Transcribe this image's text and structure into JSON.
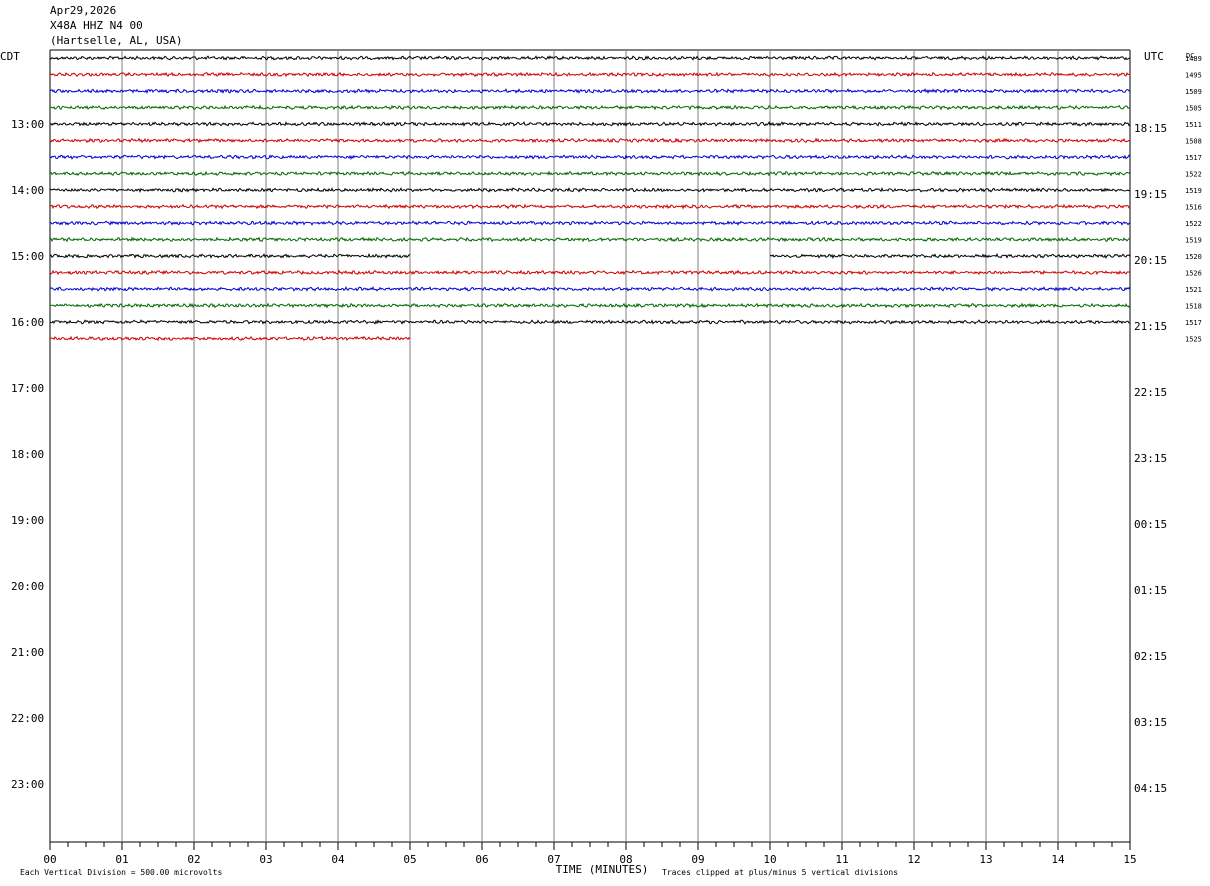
{
  "header": {
    "date": "Apr29,2026",
    "station": "X48A HHZ N4 00",
    "location": "(Hartselle, AL, USA)"
  },
  "labels": {
    "left_tz": "CDT",
    "right_tz": "UTC",
    "dc": "DC"
  },
  "footer": {
    "scale_note": "Each Vertical Division =  500.00 microvolts",
    "clip_note": "Traces clipped at plus/minus 5 vertical divisions"
  },
  "colors": {
    "trace_cycle": [
      "#000000",
      "#cc0000",
      "#0000cc",
      "#006600"
    ],
    "grid": "#7f7f7f"
  },
  "chart_data": {
    "type": "line",
    "title": "X48A HHZ N4 00",
    "xlabel": "TIME (MINUTES)",
    "ylabel": "",
    "xlim": [
      0,
      15
    ],
    "x_ticks": [
      "00",
      "01",
      "02",
      "03",
      "04",
      "05",
      "06",
      "07",
      "08",
      "09",
      "10",
      "11",
      "12",
      "13",
      "14",
      "15"
    ],
    "left_hour_labels": [
      "13:00",
      "14:00",
      "15:00",
      "16:00",
      "17:00",
      "18:00",
      "19:00",
      "20:00",
      "21:00",
      "22:00",
      "23:00"
    ],
    "right_hour_labels": [
      "18:15",
      "19:15",
      "20:15",
      "21:15",
      "22:15",
      "23:15",
      "00:15",
      "01:15",
      "02:15",
      "03:15",
      "04:15"
    ],
    "rows_per_hour": 4,
    "first_row_offset_rows": -4,
    "total_row_slots": 48,
    "rows": [
      {
        "dc": "1489",
        "start_min": 0,
        "end_min": 15
      },
      {
        "dc": "1495",
        "start_min": 0,
        "end_min": 15
      },
      {
        "dc": "1509",
        "start_min": 0,
        "end_min": 15
      },
      {
        "dc": "1505",
        "start_min": 0,
        "end_min": 15
      },
      {
        "dc": "1511",
        "start_min": 0,
        "end_min": 15
      },
      {
        "dc": "1508",
        "start_min": 0,
        "end_min": 15
      },
      {
        "dc": "1517",
        "start_min": 0,
        "end_min": 15
      },
      {
        "dc": "1522",
        "start_min": 0,
        "end_min": 15
      },
      {
        "dc": "1519",
        "start_min": 0,
        "end_min": 15
      },
      {
        "dc": "1516",
        "start_min": 0,
        "end_min": 15
      },
      {
        "dc": "1522",
        "start_min": 0,
        "end_min": 15
      },
      {
        "dc": "1519",
        "start_min": 0,
        "end_min": 15
      },
      {
        "dc": "1520",
        "segments": [
          [
            0,
            5
          ],
          [
            10,
            15
          ]
        ]
      },
      {
        "dc": "1526",
        "start_min": 0,
        "end_min": 15
      },
      {
        "dc": "1521",
        "start_min": 0,
        "end_min": 15
      },
      {
        "dc": "1518",
        "start_min": 0,
        "end_min": 15
      },
      {
        "dc": "1517",
        "start_min": 0,
        "end_min": 15
      },
      {
        "dc": "1525",
        "start_min": 0,
        "end_min": 5
      }
    ]
  }
}
